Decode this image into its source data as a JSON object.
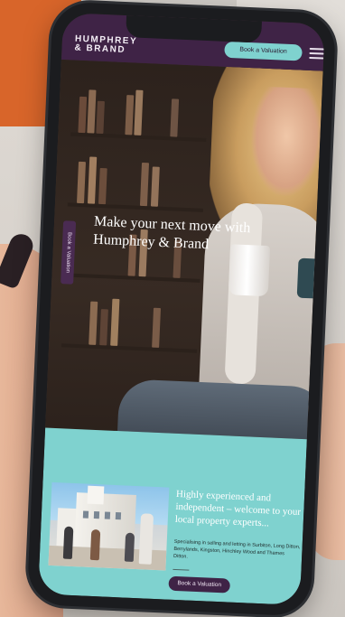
{
  "header": {
    "logo_line1": "HUMPHREY",
    "logo_line2": "& BRAND",
    "book_button_label": "Book a Valuation",
    "menu_icon": "hamburger-menu-icon"
  },
  "hero": {
    "headline": "Make your next move with Humphrey & Brand",
    "side_tab_label": "Book a Valuation"
  },
  "intro": {
    "heading": "Highly experienced and independent – welcome to your local property experts...",
    "subtext": "Specialising in selling and letting in Surbiton, Long Ditton, Berrylands, Kingston, Hinchley Wood and Thames Ditton.",
    "book_button_label": "Book a Valuation"
  },
  "colors": {
    "brand_purple": "#3f2346",
    "brand_teal": "#7fd2cf"
  }
}
